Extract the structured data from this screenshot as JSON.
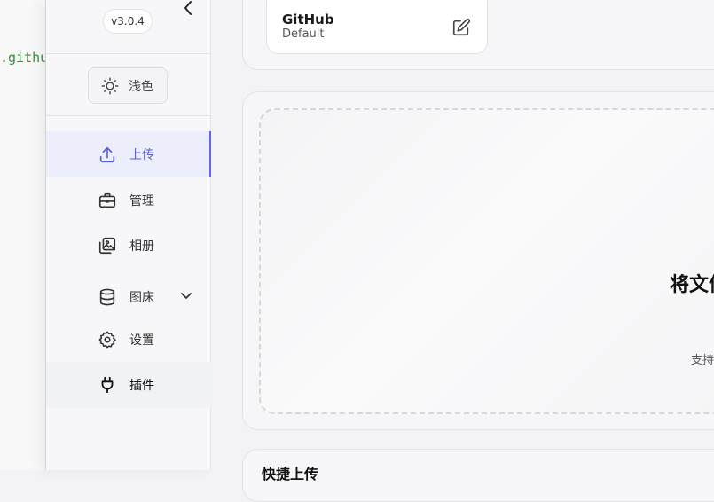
{
  "backdrop": {
    "url_fragment": ".githu"
  },
  "sidebar": {
    "version": "v3.0.4",
    "theme_label": "浅色",
    "items": [
      {
        "label": "上传",
        "icon": "upload-icon",
        "active": true
      },
      {
        "label": "管理",
        "icon": "briefcase-icon"
      },
      {
        "label": "相册",
        "icon": "gallery-icon"
      },
      {
        "label": "图床",
        "icon": "database-icon",
        "expandable": true
      },
      {
        "label": "设置",
        "icon": "gear-icon"
      },
      {
        "label": "插件",
        "icon": "plug-icon"
      }
    ]
  },
  "main": {
    "host": {
      "name": "GitHub",
      "config": "Default"
    },
    "dropzone": {
      "title": "将文件",
      "hint": "支持"
    },
    "section_title": "快捷上传"
  },
  "colors": {
    "accent": "#6366f1",
    "active_bg": "#eceefb"
  }
}
